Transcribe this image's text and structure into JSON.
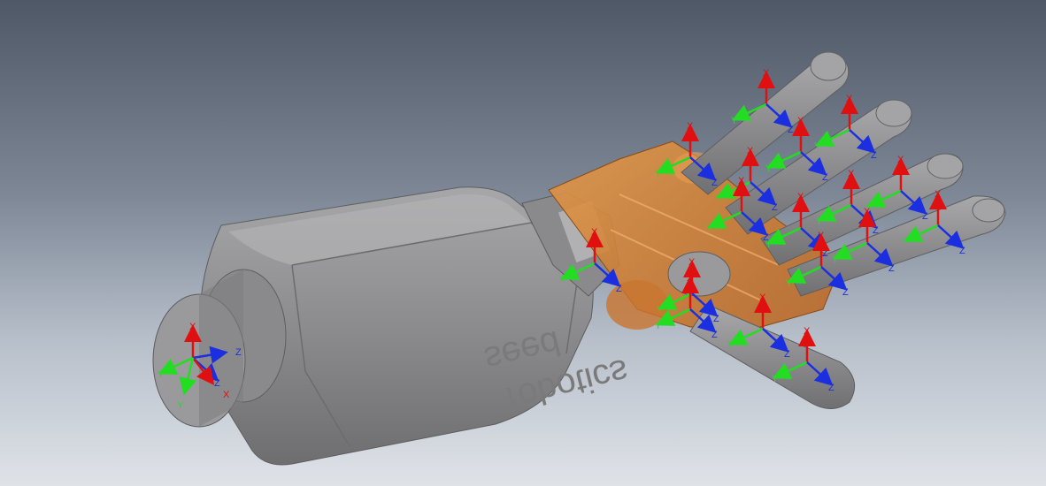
{
  "model": {
    "brand_line1": "seed",
    "brand_line2": "robotics"
  },
  "axis_labels": {
    "x": "X",
    "y": "Y",
    "z": "Z"
  },
  "colors": {
    "x_axis": "#e01010",
    "y_axis": "#22dd22",
    "z_axis": "#1b2fe0",
    "palm": "#d9822b",
    "body": "#8f8f91"
  }
}
